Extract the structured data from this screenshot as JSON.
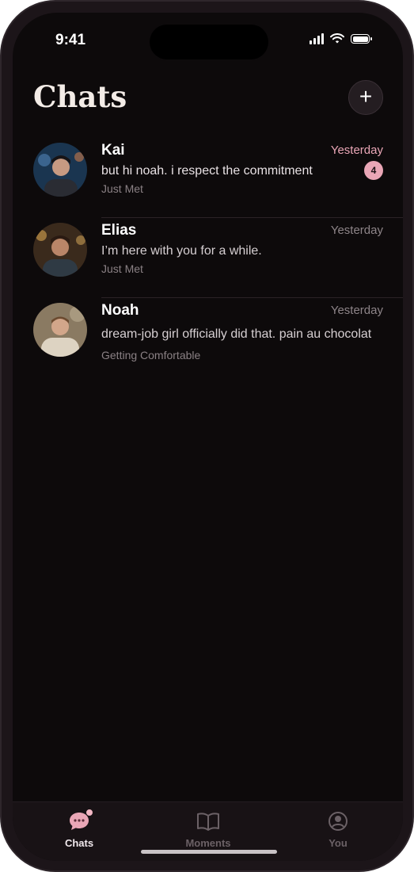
{
  "status_bar": {
    "time": "9:41"
  },
  "header": {
    "title": "Chats",
    "add_label": "+"
  },
  "chats": [
    {
      "name": "Kai",
      "time": "Yesterday",
      "preview": "but hi noah. i respect the commitment",
      "status": "Just Met",
      "unread_count": "4",
      "unread": true
    },
    {
      "name": "Elias",
      "time": "Yesterday",
      "preview": "I’m here with you for a while.",
      "status": "Just Met",
      "unread": false
    },
    {
      "name": "Noah",
      "time": "Yesterday",
      "preview": "dream-job girl officially did that. pain au chocolat",
      "status": "Getting Comfortable",
      "unread": false
    }
  ],
  "tabs": [
    {
      "label": "Chats",
      "icon": "chat-bubble-icon",
      "active": true
    },
    {
      "label": "Moments",
      "icon": "book-icon",
      "active": false
    },
    {
      "label": "You",
      "icon": "profile-icon",
      "active": false
    }
  ],
  "colors": {
    "accent": "#e9a6b6",
    "background": "#0d0a0b",
    "tab_bar": "#181215"
  }
}
